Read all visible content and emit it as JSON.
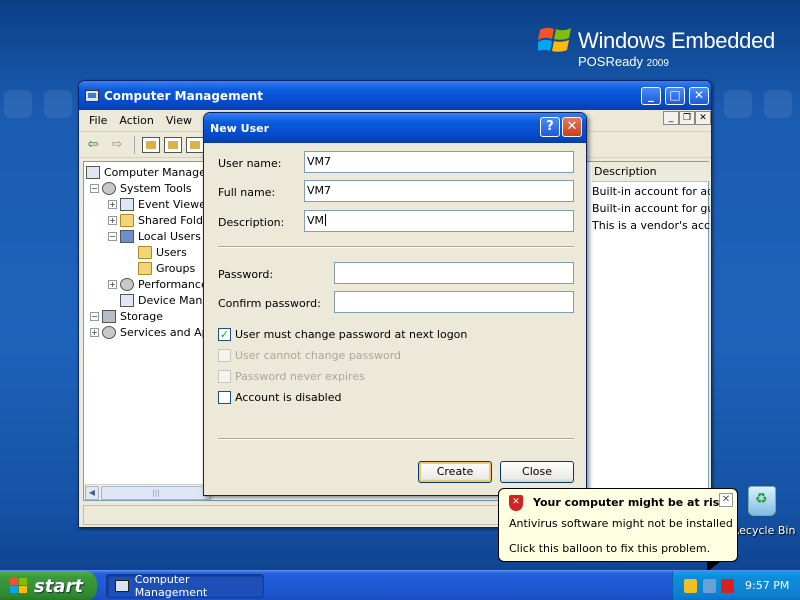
{
  "desktop": {
    "brand_line1": "Windows Embedded",
    "brand_line2": "POSReady",
    "brand_year": "2009",
    "recycle_bin_label": "Recycle Bin"
  },
  "cm_window": {
    "title": "Computer Management",
    "menu": [
      "File",
      "Action",
      "View"
    ],
    "tree": [
      "Computer Management",
      "System Tools",
      "Event Viewer",
      "Shared Folders",
      "Local Users and Groups",
      "Users",
      "Groups",
      "Performance",
      "Device Manager",
      "Storage",
      "Services and Applications"
    ],
    "list_header": "Description",
    "list_rows": [
      "Built-in account for administering the computer/domain",
      "Built-in account for guest access to the computer/domain",
      "This is a vendor's account for the Help and Support Service"
    ]
  },
  "dialog": {
    "title": "New User",
    "help": "?",
    "close": "X",
    "username_label": "User name:",
    "username_value": "VM7",
    "fullname_label": "Full name:",
    "fullname_value": "VM7",
    "description_label": "Description:",
    "description_value": "VM",
    "password_label": "Password:",
    "password_value": "",
    "confirm_label": "Confirm password:",
    "confirm_value": "",
    "chk_must_change": "User must change password at next logon",
    "chk_must_change_checked": true,
    "chk_cannot_change": "User cannot change password",
    "chk_never_expires": "Password never expires",
    "chk_disabled": "Account is disabled",
    "create_label": "Create",
    "close_label": "Close"
  },
  "balloon": {
    "title": "Your computer might be at risk",
    "line1": "Antivirus software might not be installed",
    "line2": "Click this balloon to fix this problem."
  },
  "taskbar": {
    "start_label": "start",
    "task_label": "Computer Management",
    "clock": "9:57 PM"
  },
  "colors": {
    "accent_title": "#0a5be0",
    "taskbar": "#245edb",
    "start_green": "#3c9a3c",
    "tray": "#0f80d2",
    "balloon_bg": "#ffffe1"
  }
}
